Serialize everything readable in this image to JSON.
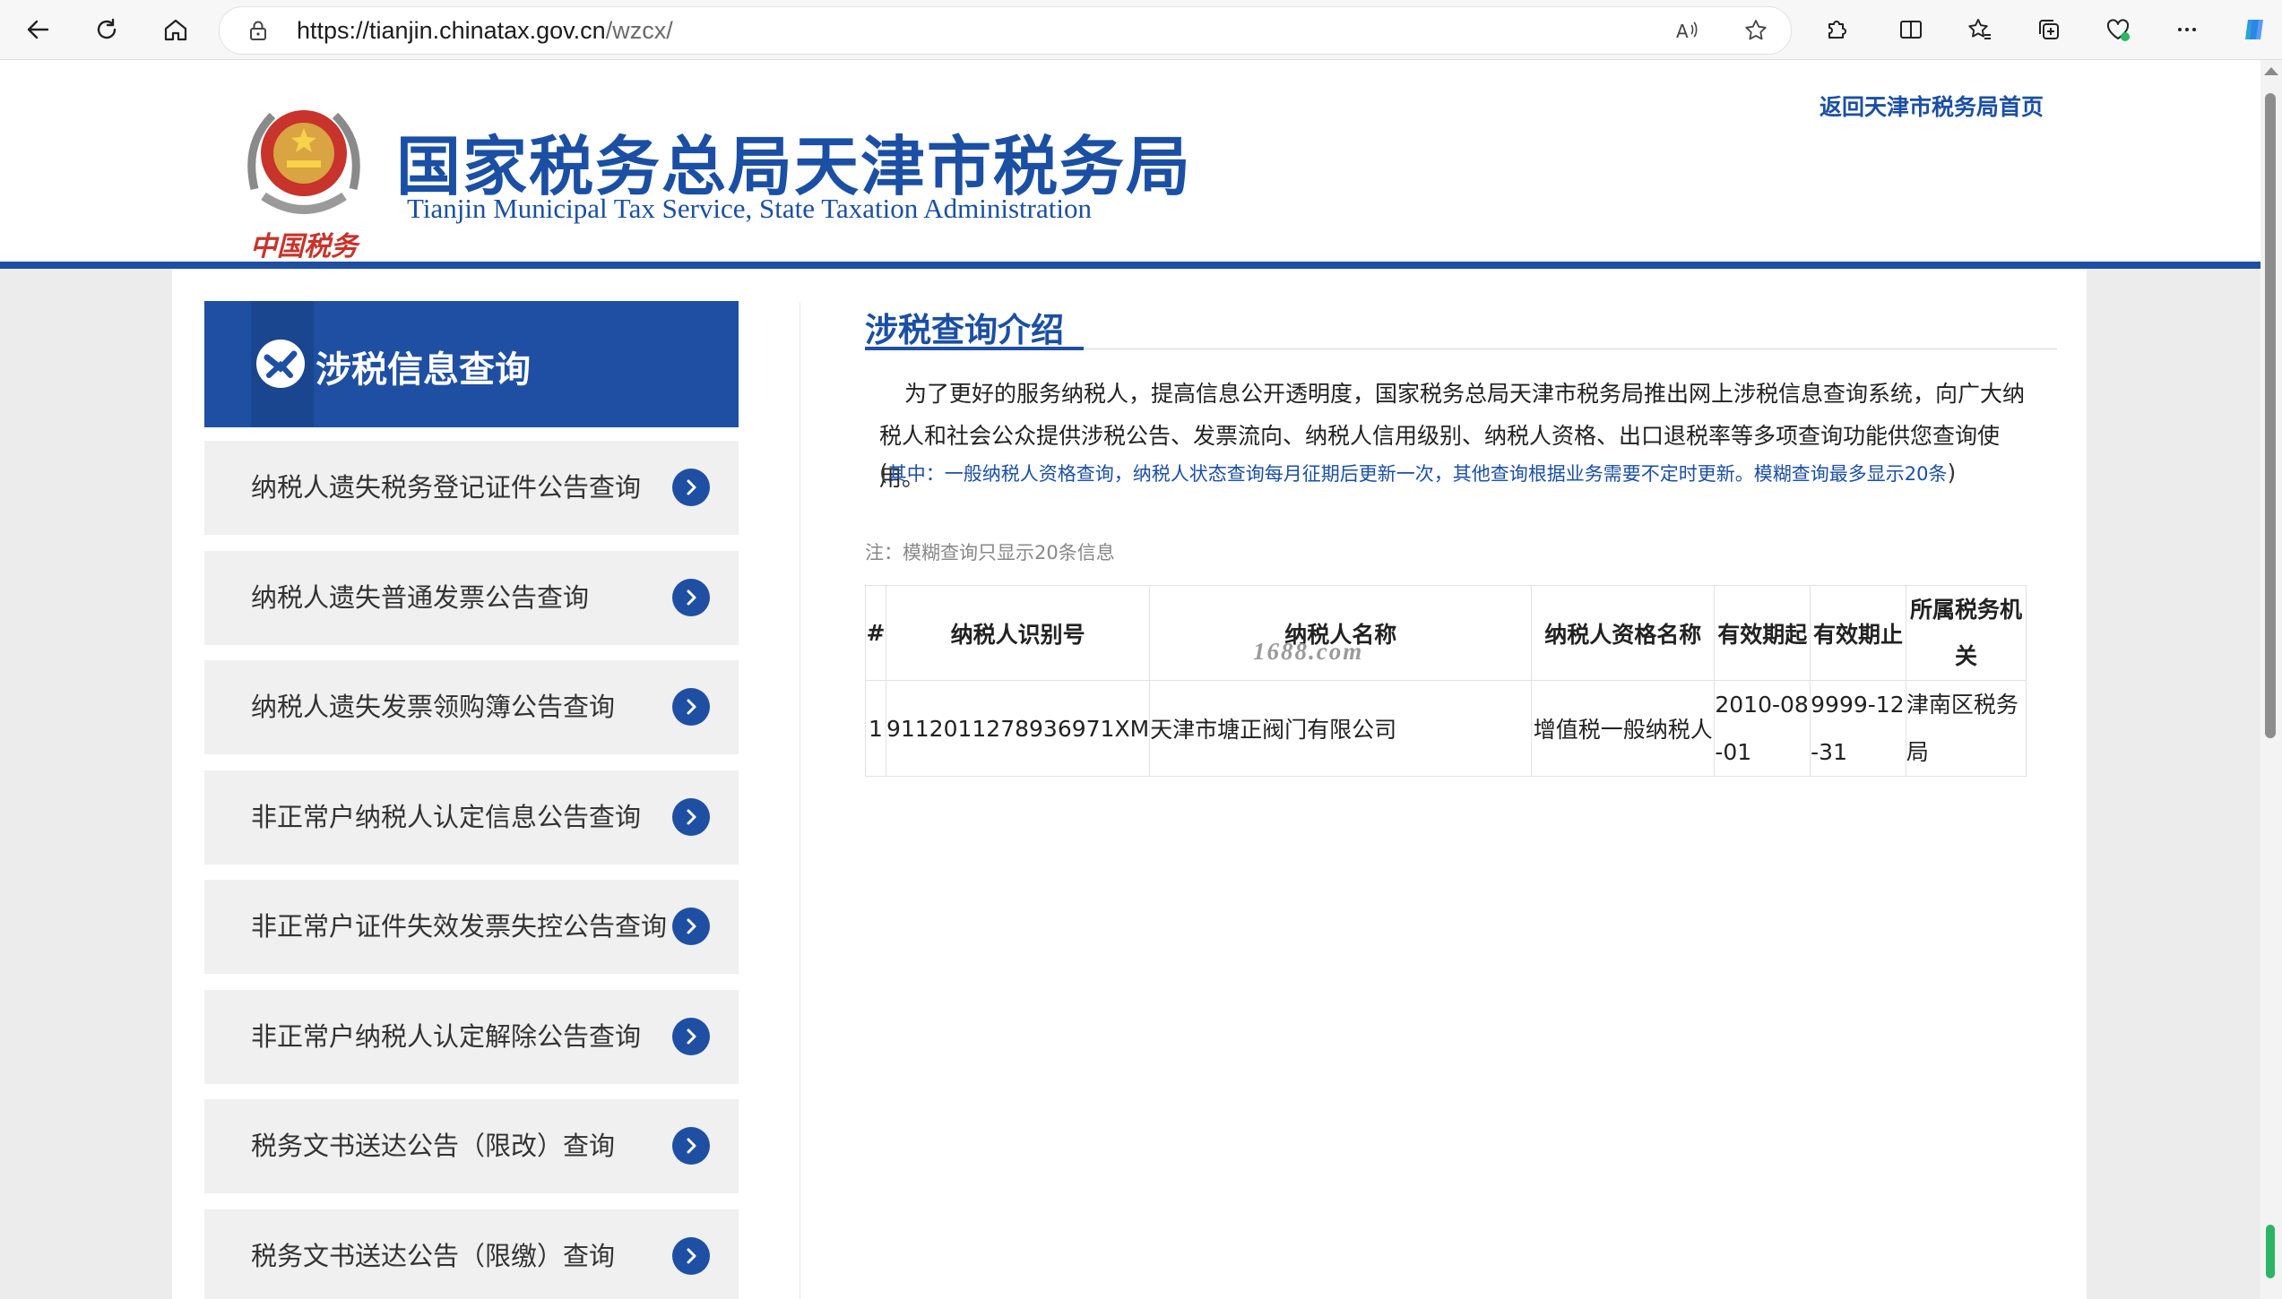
{
  "browser": {
    "url": "https://tianjin.chinatax.gov.cn/wzcx/",
    "url_host": "https://tianjin.chinatax.gov.cn",
    "url_path": "/wzcx/"
  },
  "header": {
    "title": "国家税务总局天津市税务局",
    "subtitle": "Tianjin Municipal Tax Service, State Taxation Administration",
    "home_link": "返回天津市税务局首页",
    "emblem_caption": "中国税务"
  },
  "sidebar": {
    "title": "涉税信息查询",
    "items": [
      {
        "label": "纳税人遗失税务登记证件公告查询"
      },
      {
        "label": "纳税人遗失普通发票公告查询"
      },
      {
        "label": "纳税人遗失发票领购簿公告查询"
      },
      {
        "label": "非正常户纳税人认定信息公告查询"
      },
      {
        "label": "非正常户证件失效发票失控公告查询"
      },
      {
        "label": "非正常户纳税人认定解除公告查询"
      },
      {
        "label": "税务文书送达公告（限改）查询"
      },
      {
        "label": "税务文书送达公告（限缴）查询"
      }
    ]
  },
  "main": {
    "title": "涉税查询介绍",
    "intro": "为了更好的服务纳税人，提高信息公开透明度，国家税务总局天津市税务局推出网上涉税信息查询系统，向广大纳税人和社会公众提供涉税公告、发票流向、纳税人信用级别、纳税人资格、出口退税率等多项查询功能供您查询使用。",
    "intro_note_open": "(",
    "intro_note": "其中：一般纳税人资格查询，纳税人状态查询每月征期后更新一次，其他查询根据业务需要不定时更新。模糊查询最多显示20条",
    "intro_note_close": ")",
    "note": "注：模糊查询只显示20条信息",
    "watermark": "1688.com",
    "table": {
      "headers": [
        "#",
        "纳税人识别号",
        "纳税人名称",
        "纳税人资格名称",
        "有效期起",
        "有效期止",
        "所属税务机关"
      ],
      "rows": [
        [
          "1",
          "9112011278936971XM",
          "天津市塘正阀门有限公司",
          "增值税一般纳税人",
          "2010-08-01",
          "9999-12-31",
          "津南区税务局"
        ]
      ]
    }
  },
  "colors": {
    "brand_blue": "#1f4fa3",
    "accent_green": "#2bb565"
  },
  "icons": [
    "back-arrow-icon",
    "refresh-icon",
    "home-icon",
    "lock-icon",
    "read-aloud-icon",
    "favorite-star-icon",
    "extensions-icon",
    "split-screen-icon",
    "favorites-icon",
    "collections-icon",
    "browser-essentials-icon",
    "more-icon",
    "copilot-icon",
    "chevron-right-icon"
  ]
}
